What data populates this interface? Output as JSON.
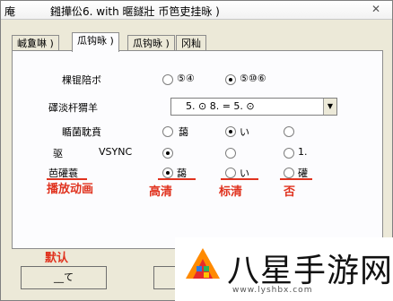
{
  "window": {
    "icon": "庵",
    "title": "鎺撶伀6. with 暱鐩壯 币笆吏挂昹 )",
    "close_glyph": "✕"
  },
  "tabs": [
    {
      "label": "峸敻啉 )",
      "active": false
    },
    {
      "label": "瓜钩昹 )",
      "active": true
    },
    {
      "label": "瓜钩昹 )",
      "active": false
    },
    {
      "label": "冈籼",
      "active": false
    }
  ],
  "settings": {
    "row1": {
      "label": "棵锟陪ボ",
      "opt1": "⑤④",
      "opt2": "⑤⑩⑥"
    },
    "row2": {
      "label": "礋淡杆猬羊",
      "combo": "5.       ⊙ 8.         =           5.       ⊙"
    },
    "row3": {
      "label": "瞃菌耽賁",
      "opt1": "藹",
      "opt2": "い",
      "opt3": ""
    },
    "row4": {
      "label": "驱",
      "label2": "VSYNC",
      "opt3": "1."
    },
    "row5": {
      "label": "芭礶蓑",
      "opt1": "藹",
      "opt2": "い",
      "opt3": "礶"
    }
  },
  "annotations": {
    "play_animation": "播放动画",
    "high": "高清",
    "standard": "标清",
    "no": "否",
    "default": "默认"
  },
  "buttons": {
    "ok": "__て"
  },
  "watermark": {
    "text": "八星手游网",
    "url": "www.lyshbx.com"
  },
  "colors": {
    "annotation": "#e0321e",
    "window_bg": "#ece9d8",
    "panel_bg": "#fcfcfe"
  }
}
